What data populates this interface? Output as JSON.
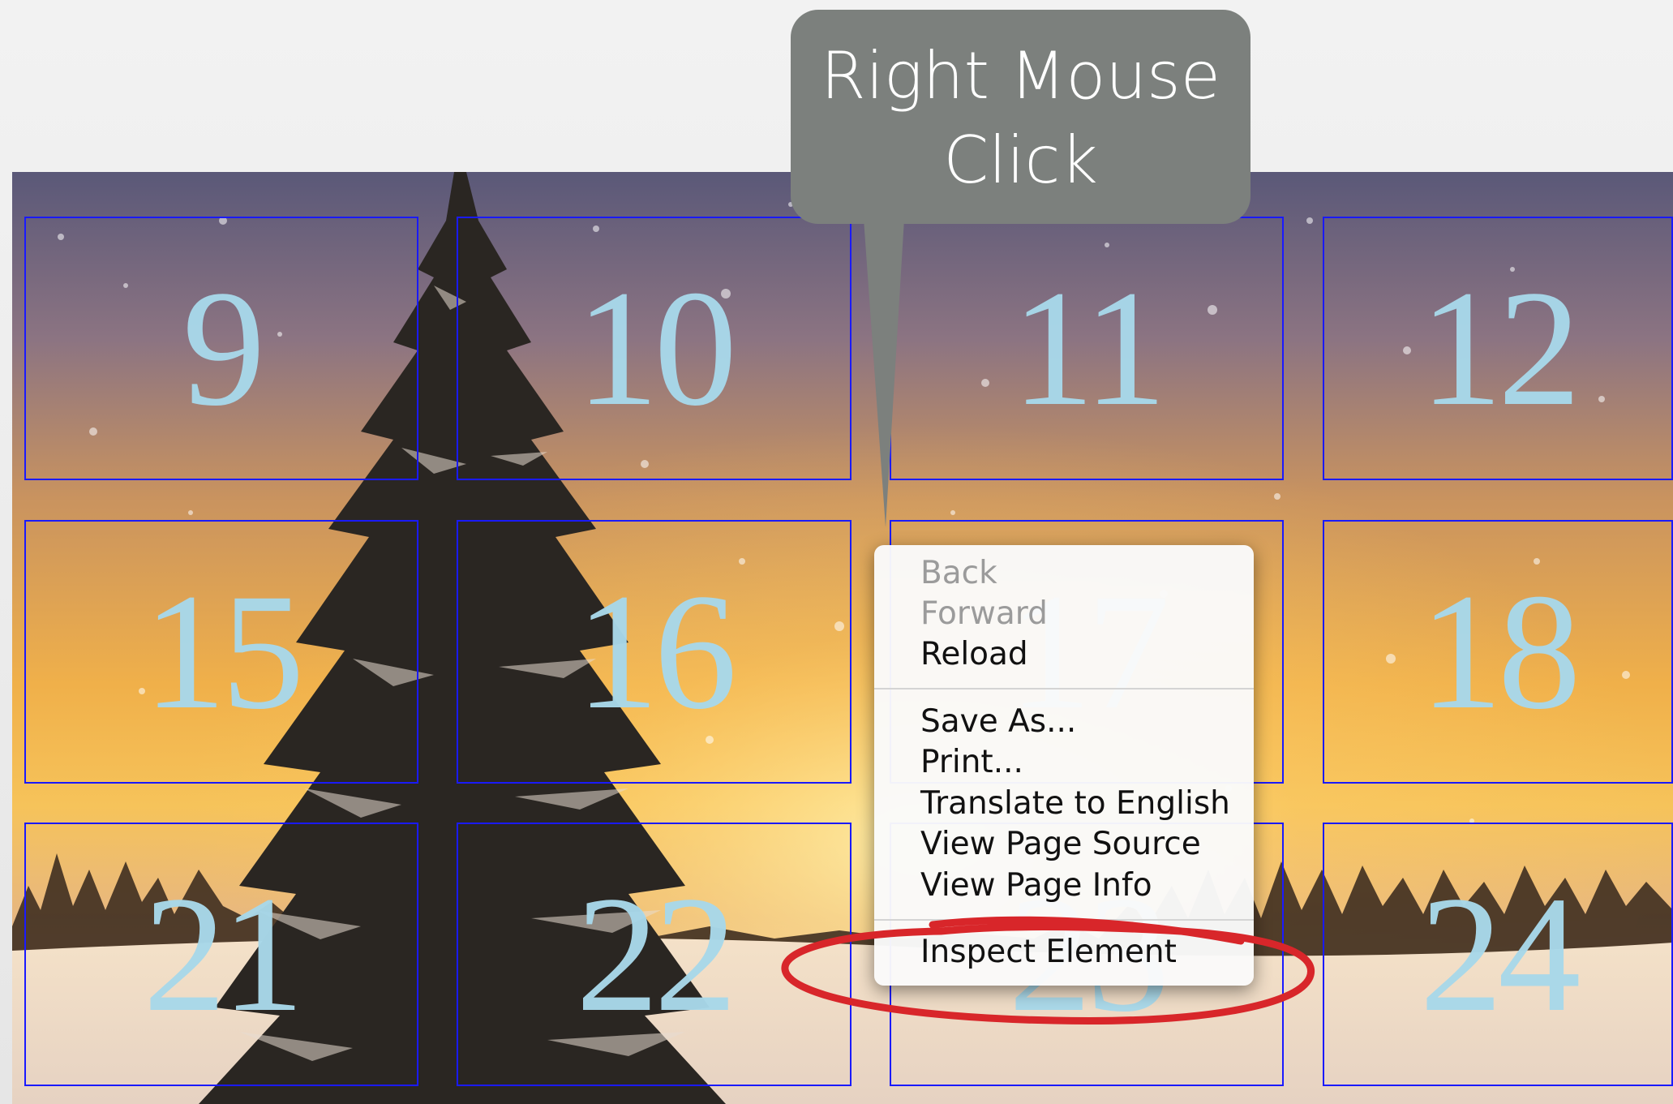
{
  "calendar": {
    "cells": [
      {
        "label": "9"
      },
      {
        "label": "10"
      },
      {
        "label": "11"
      },
      {
        "label": "12"
      },
      {
        "label": "15"
      },
      {
        "label": "16"
      },
      {
        "label": "17"
      },
      {
        "label": "18"
      },
      {
        "label": "21"
      },
      {
        "label": "22"
      },
      {
        "label": "23"
      },
      {
        "label": "24"
      }
    ]
  },
  "callout": {
    "line1": "Right Mouse",
    "line2": "Click"
  },
  "context_menu": {
    "items": [
      {
        "label": "Back",
        "enabled": false
      },
      {
        "label": "Forward",
        "enabled": false
      },
      {
        "label": "Reload",
        "enabled": true
      },
      {
        "label": "Save As...",
        "enabled": true
      },
      {
        "label": "Print...",
        "enabled": true
      },
      {
        "label": "Translate to English",
        "enabled": true
      },
      {
        "label": "View Page Source",
        "enabled": true
      },
      {
        "label": "View Page Info",
        "enabled": true
      },
      {
        "label": "Inspect Element",
        "enabled": true
      }
    ]
  },
  "colors": {
    "grid_border": "#1a1aff",
    "number": "#a8d8ea",
    "callout_bg": "#7c807d",
    "highlight_ring": "#d8262a"
  }
}
